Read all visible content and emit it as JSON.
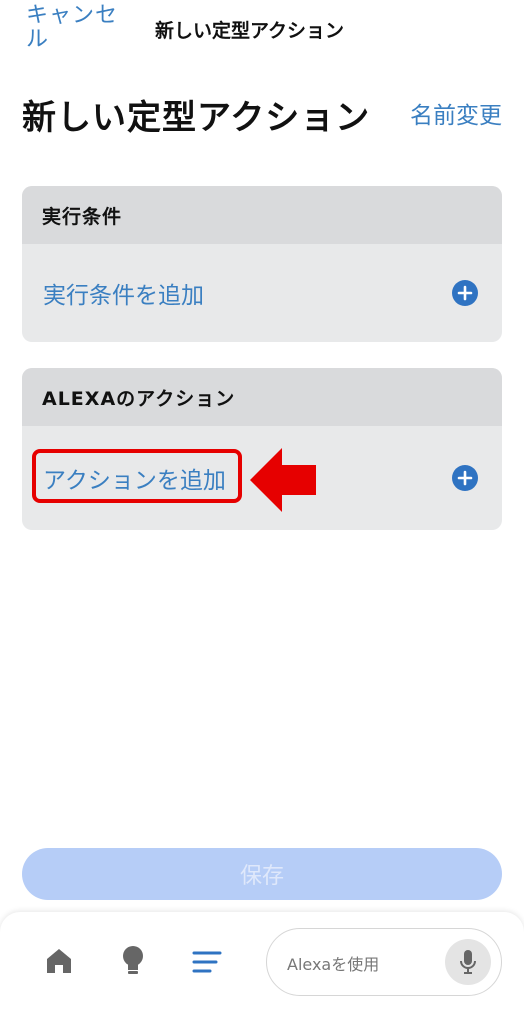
{
  "header": {
    "cancel_label": "キャンセル",
    "title": "新しい定型アクション"
  },
  "page": {
    "title": "新しい定型アクション",
    "rename_label": "名前変更"
  },
  "trigger_section": {
    "header": "実行条件",
    "add_label": "実行条件を追加"
  },
  "action_section": {
    "header": "ALEXAのアクション",
    "add_label": "アクションを追加"
  },
  "save_label": "保存",
  "bottom_nav": {
    "items": [
      {
        "icon": "home-icon"
      },
      {
        "icon": "lightbulb-icon"
      },
      {
        "icon": "menu-lines-icon"
      }
    ],
    "alexa_placeholder": "Alexaを使用"
  },
  "colors": {
    "accent": "#3a7fc1",
    "plus": "#2f73c2",
    "highlight": "#e60000",
    "save_bg": "#b6cdf7",
    "active_nav": "#2f73c2"
  }
}
